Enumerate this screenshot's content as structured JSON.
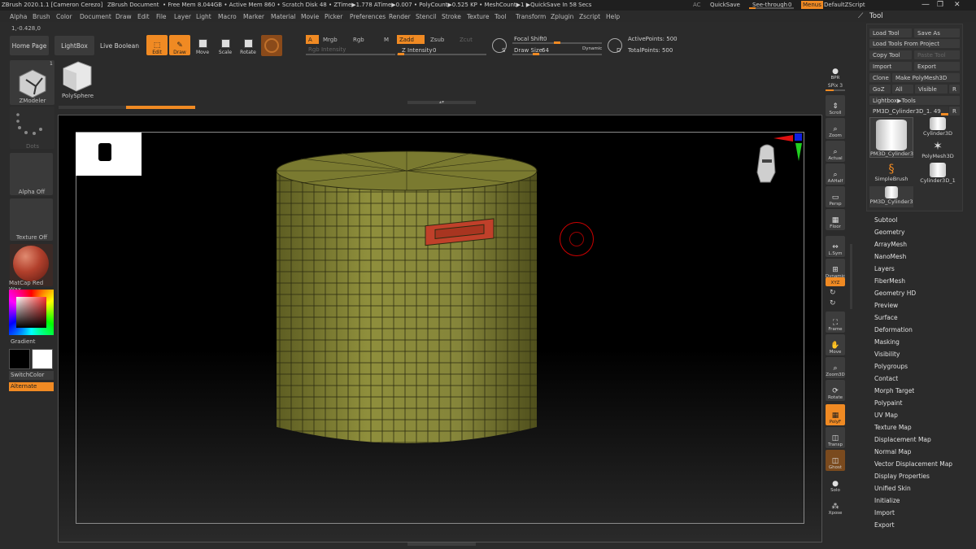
{
  "titlebar": {
    "app": "ZBrush 2020.1.1 [Cameron Cerezo]",
    "doc": "ZBrush Document",
    "stats": "• Free Mem 8.044GB • Active Mem 860 • Scratch Disk 48 • ZTime▶1.778 ATime▶0.007 • PolyCount▶0.525 KP • MeshCount▶1 ▶QuickSave In 58 Secs",
    "ac": "AC",
    "quicksave": "QuickSave",
    "seethrough": "See-through",
    "seethrough_value": "0",
    "menus": "Menus",
    "script": "DefaultZScript"
  },
  "menubar": [
    "Alpha",
    "Brush",
    "Color",
    "Document",
    "Draw",
    "Edit",
    "File",
    "Layer",
    "Light",
    "Macro",
    "Marker",
    "Material",
    "Movie",
    "Picker",
    "Preferences",
    "Render",
    "Stencil",
    "Stroke",
    "Texture",
    "Tool",
    "Transform",
    "Zplugin",
    "Zscript",
    "Help"
  ],
  "coordinate": "1,-0.428,0",
  "shelf": {
    "home": "Home Page",
    "lightbox": "LightBox",
    "liveboolean": "Live Boolean",
    "edit": "Edit",
    "draw": "Draw",
    "move": "Move",
    "scale": "Scale",
    "rotate": "Rotate",
    "a": "A",
    "mrgb": "Mrgb",
    "rgb": "Rgb",
    "m": "M",
    "zadd": "Zadd",
    "zsub": "Zsub",
    "zcut": "Zcut",
    "rgb_intensity": "Rgb Intensity",
    "z_intensity": "Z Intensity",
    "z_intensity_value": "0",
    "focal_shift": "Focal Shift",
    "focal_shift_value": "0",
    "draw_size": "Draw Size",
    "draw_size_value": "64",
    "dynamic": "Dynamic",
    "active_points": "ActivePoints: 500",
    "total_points": "TotalPoints: 500"
  },
  "leftpanel": {
    "zmodeler": "ZModeler",
    "polysphere": "PolySphere",
    "dots": "Dots",
    "alpha_off": "Alpha Off",
    "texture_off": "Texture Off",
    "matcap": "MatCap Red Wax",
    "gradient": "Gradient",
    "switchcolor": "SwitchColor",
    "alternate": "Alternate",
    "badge": "1"
  },
  "rightcol": [
    "BPR",
    "SPix 3",
    "Scroll",
    "Zoom",
    "Actual",
    "AAHalf",
    "Persp",
    "Floor",
    "L.Sym",
    "Dynamic",
    "XYZ",
    "Frame",
    "Move",
    "Zoom3D",
    "Rotate",
    "PolyF",
    "Transp",
    "Ghost",
    "Solo",
    "Xpose"
  ],
  "toolpanel": {
    "title": "Tool",
    "load": "Load Tool",
    "saveas": "Save As",
    "loadproj": "Load Tools From Project",
    "copy": "Copy Tool",
    "paste": "Paste Tool",
    "import": "Import",
    "export": "Export",
    "clone": "Clone",
    "makepoly": "Make PolyMesh3D",
    "goz": "GoZ",
    "all": "All",
    "visible": "Visible",
    "r": "R",
    "lightboxtools": "Lightbox▶Tools",
    "current": "PM3D_Cylinder3D_1. 49",
    "thumbs": [
      "PM3D_Cylinder3",
      "Cylinder3D",
      "SimpleBrush",
      "PolyMesh3D",
      "Cylinder3D_1",
      "PM3D_Cylinder3"
    ]
  },
  "subpalettes": [
    "Subtool",
    "Geometry",
    "ArrayMesh",
    "NanoMesh",
    "Layers",
    "FiberMesh",
    "Geometry HD",
    "Preview",
    "Surface",
    "Deformation",
    "Masking",
    "Visibility",
    "Polygroups",
    "Contact",
    "Morph Target",
    "Polypaint",
    "UV Map",
    "Texture Map",
    "Displacement Map",
    "Normal Map",
    "Vector Displacement Map",
    "Display Properties",
    "Unified Skin",
    "Initialize",
    "Import",
    "Export"
  ],
  "colors": {
    "accent": "#f08a23",
    "mesh": "#8a8a3a",
    "mask": "#c0402a"
  }
}
